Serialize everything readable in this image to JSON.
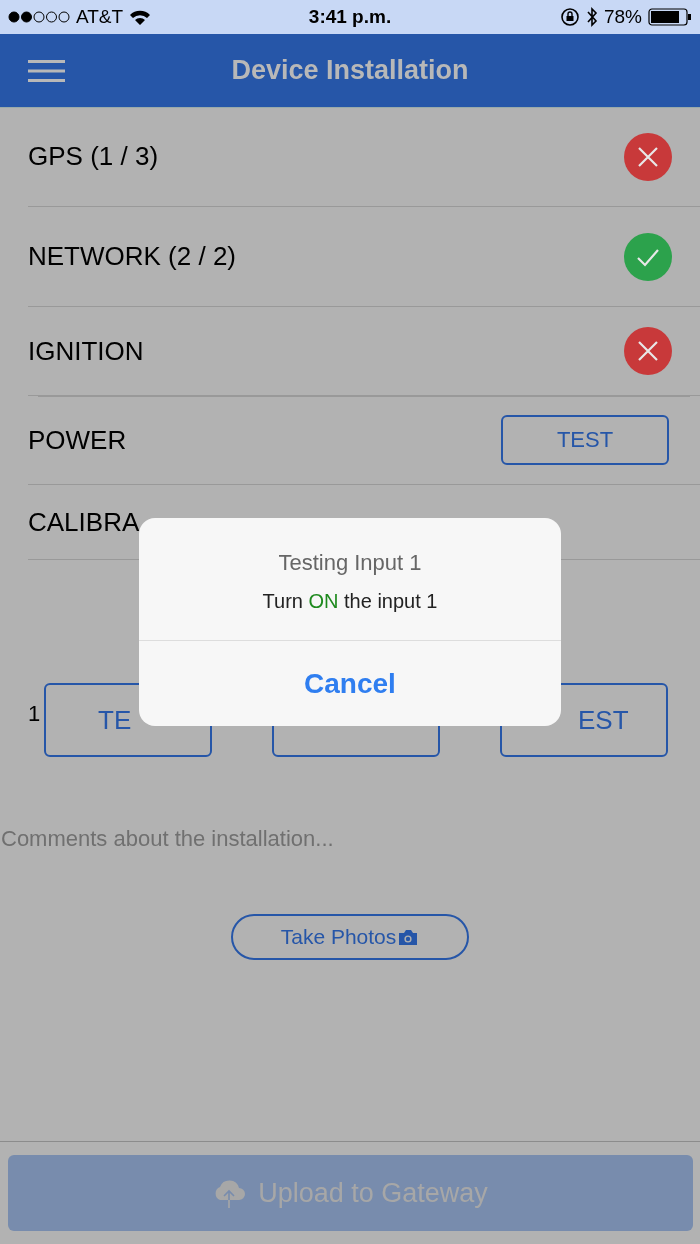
{
  "status_bar": {
    "carrier": "AT&T",
    "time": "3:41 p.m.",
    "battery": "78%"
  },
  "nav": {
    "title": "Device Installation"
  },
  "checks": [
    {
      "label": "GPS (1 / 3)",
      "kind": "fail"
    },
    {
      "label": "NETWORK (2 / 2)",
      "kind": "ok"
    },
    {
      "label": "IGNITION",
      "kind": "fail"
    },
    {
      "label": "POWER",
      "kind": "test",
      "button": "TEST"
    },
    {
      "label": "CALIBRA",
      "kind": "none"
    }
  ],
  "inputs": {
    "label": "1",
    "buttons": [
      {
        "kind": "test",
        "label": "TE"
      },
      {
        "kind": "test"
      },
      {
        "kind": "test",
        "label": "EST"
      }
    ]
  },
  "comments": {
    "placeholder": "Comments about the installation..."
  },
  "photos_button": "Take Photos",
  "upload_button": {
    "label": "Upload to Gateway",
    "disabled": true
  },
  "dialog": {
    "title": "Testing Input 1",
    "message": {
      "before": "Turn ",
      "highlight": "ON",
      "after": " the input 1"
    },
    "action": "Cancel"
  }
}
